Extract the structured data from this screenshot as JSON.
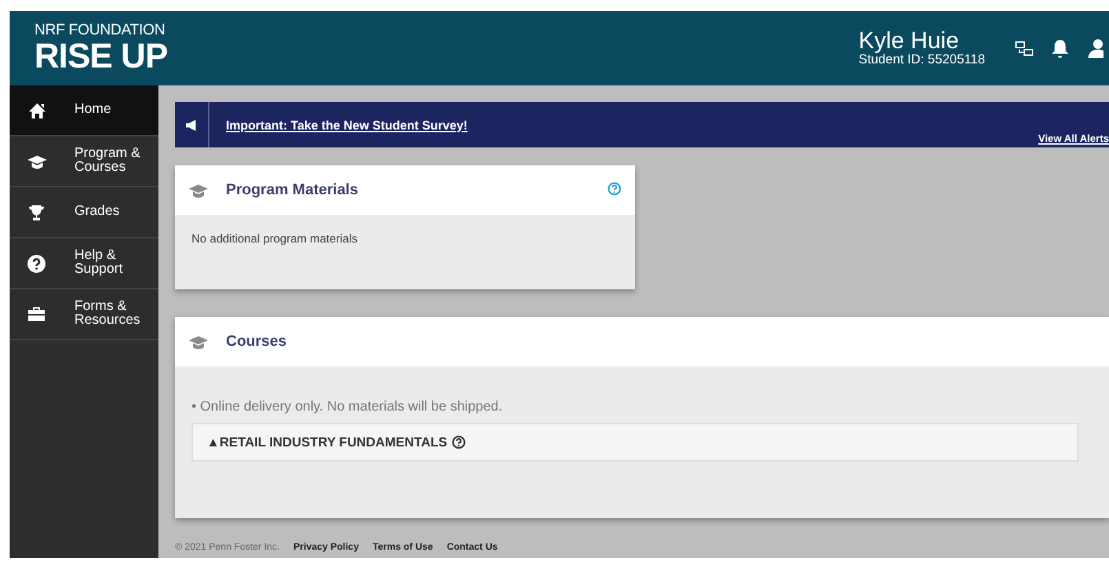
{
  "header": {
    "brand_top": "NRF FOUNDATION",
    "brand_main": "RISE UP",
    "user_name": "Kyle Huie",
    "student_id": "Student ID: 55205118"
  },
  "sidebar": {
    "items": [
      {
        "label": "Home",
        "selected": true
      },
      {
        "label": "Program & Courses",
        "selected": false
      },
      {
        "label": "Grades",
        "selected": false
      },
      {
        "label": "Help & Support",
        "selected": false
      },
      {
        "label": "Forms & Resources",
        "selected": false
      }
    ]
  },
  "alert": {
    "link": "Important: Take the New Student Survey!",
    "view_all": "View All Alerts"
  },
  "program_materials": {
    "title": "Program Materials",
    "body": "No additional program materials"
  },
  "courses": {
    "title": "Courses",
    "note": "• Online delivery only. No materials will be shipped.",
    "items": [
      {
        "label": "▲RETAIL INDUSTRY FUNDAMENTALS"
      }
    ]
  },
  "footer": {
    "copyright": "© 2021 Penn Foster Inc.",
    "links": [
      "Privacy Policy",
      "Terms of Use",
      "Contact Us"
    ]
  }
}
